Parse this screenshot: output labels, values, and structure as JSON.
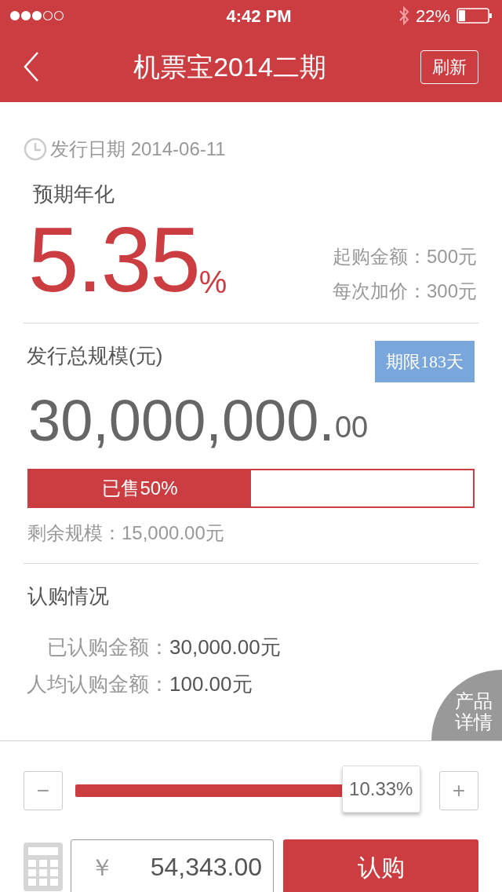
{
  "status_bar": {
    "time": "4:42 PM",
    "battery": "22%"
  },
  "nav": {
    "title": "机票宝2014二期",
    "refresh": "刷新"
  },
  "issue_date": "发行日期 2014-06-11",
  "yield": {
    "label": "预期年化",
    "value": "5.35",
    "unit": "%"
  },
  "terms": [
    {
      "label": "起购金额：",
      "value": "500元"
    },
    {
      "label": "每次加价：",
      "value": "300元"
    }
  ],
  "scale": {
    "label": "发行总规模(元)",
    "term_badge": "期限183天",
    "amount": "30,000,000.",
    "decimals": "00"
  },
  "sold": {
    "label": "已售50%",
    "level": 0.5
  },
  "remaining": "剩余规模：15,000.00元",
  "subscription": {
    "title": "认购情况",
    "rows": [
      {
        "label": "已认购金额：",
        "value": "30,000.00元"
      },
      {
        "label": "人均认购金额：",
        "value": "100.00元"
      }
    ]
  },
  "details_button": {
    "line1": "产品",
    "line2": "详情"
  },
  "slider": {
    "minus": "−",
    "plus": "+",
    "reading": "10.33%",
    "level": 0.87
  },
  "amount_field": {
    "currency": "￥",
    "value": "54,343.00"
  },
  "buy_button": "认购"
}
